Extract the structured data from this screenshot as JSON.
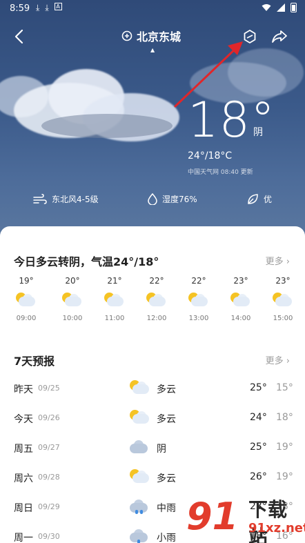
{
  "status_bar": {
    "time": "8:59",
    "left_icons": [
      "download-icon",
      "download-icon",
      "a-badge-icon"
    ],
    "right_icons": [
      "wifi-icon",
      "signal-icon",
      "battery-icon"
    ]
  },
  "header": {
    "location": "北京东城",
    "icons": [
      "back-icon",
      "location-pin-icon",
      "hexagon-icon",
      "share-icon"
    ]
  },
  "current": {
    "temperature": "18°",
    "condition": "阴",
    "range": "24°/18°C",
    "update": "中国天气网 08:40 更新"
  },
  "metrics": {
    "wind": "东北风4-5级",
    "humidity": "湿度76%",
    "air": "优"
  },
  "today": {
    "title": "今日多云转阴，气温24°/18°",
    "more": "更多",
    "hours": [
      {
        "temp": "19°",
        "time": "09:00",
        "icon": "partly-cloudy-icon"
      },
      {
        "temp": "20°",
        "time": "10:00",
        "icon": "partly-cloudy-icon"
      },
      {
        "temp": "21°",
        "time": "11:00",
        "icon": "partly-cloudy-icon"
      },
      {
        "temp": "22°",
        "time": "12:00",
        "icon": "partly-cloudy-icon"
      },
      {
        "temp": "22°",
        "time": "13:00",
        "icon": "partly-cloudy-icon"
      },
      {
        "temp": "23°",
        "time": "14:00",
        "icon": "partly-cloudy-icon"
      },
      {
        "temp": "23°",
        "time": "15:00",
        "icon": "partly-cloudy-icon"
      }
    ]
  },
  "week": {
    "title": "7天预报",
    "more": "更多",
    "days": [
      {
        "name": "昨天",
        "date": "09/25",
        "icon": "partly-cloudy-icon",
        "condition": "多云",
        "high": "25°",
        "low": "15°"
      },
      {
        "name": "今天",
        "date": "09/26",
        "icon": "partly-cloudy-icon",
        "condition": "多云",
        "high": "24°",
        "low": "18°"
      },
      {
        "name": "周五",
        "date": "09/27",
        "icon": "overcast-icon",
        "condition": "阴",
        "high": "25°",
        "low": "19°"
      },
      {
        "name": "周六",
        "date": "09/28",
        "icon": "partly-cloudy-icon",
        "condition": "多云",
        "high": "26°",
        "low": "19°"
      },
      {
        "name": "周日",
        "date": "09/29",
        "icon": "rain-icon",
        "condition": "中雨",
        "high": "23°",
        "low": "18°"
      },
      {
        "name": "周一",
        "date": "09/30",
        "icon": "rain-icon",
        "condition": "小雨",
        "high": "18°",
        "low": "16°"
      }
    ]
  },
  "watermark": {
    "number": "91",
    "text": "下载站",
    "url": "91xz.net"
  },
  "colors": {
    "sky_top": "#2f4a78",
    "sky_bottom": "#5a779f",
    "annotation_arrow": "#e0262a",
    "sun": "#f5c324",
    "watermark_red": "#e23c2c"
  }
}
